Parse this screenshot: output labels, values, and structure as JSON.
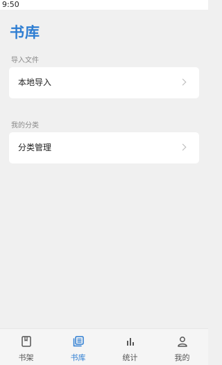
{
  "status_bar": {
    "time": "9:50"
  },
  "page": {
    "title": "书库"
  },
  "sections": [
    {
      "label": "导入文件",
      "items": [
        {
          "label": "本地导入"
        }
      ]
    },
    {
      "label": "我的分类",
      "items": [
        {
          "label": "分类管理"
        }
      ]
    }
  ],
  "bottom_nav": {
    "active_index": 1,
    "items": [
      {
        "label": "书架",
        "icon": "bookshelf-icon"
      },
      {
        "label": "书库",
        "icon": "library-icon"
      },
      {
        "label": "统计",
        "icon": "bar-chart-icon"
      },
      {
        "label": "我的",
        "icon": "person-icon"
      }
    ]
  },
  "colors": {
    "accent": "#2d7dd2",
    "background": "#f0f0f0",
    "card": "#ffffff",
    "muted_text": "#8a8a8a"
  }
}
